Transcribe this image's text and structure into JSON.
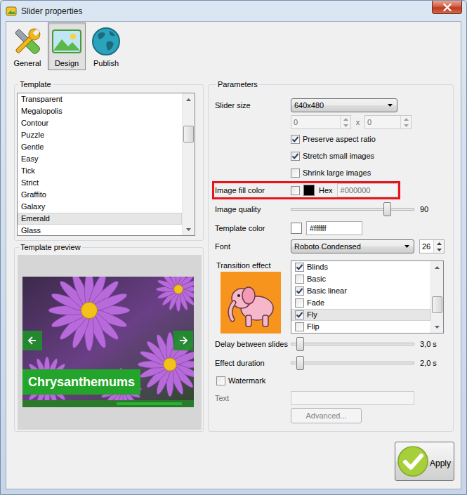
{
  "window": {
    "title": "Slider properties"
  },
  "toolbar": [
    {
      "label": "General",
      "selected": false
    },
    {
      "label": "Design",
      "selected": true
    },
    {
      "label": "Publish",
      "selected": false
    }
  ],
  "template": {
    "title": "Template",
    "scroll_level": 0.2,
    "items": [
      {
        "label": "Transparent",
        "selected": false
      },
      {
        "label": "Megalopolis",
        "selected": false
      },
      {
        "label": "Contour",
        "selected": false
      },
      {
        "label": "Puzzle",
        "selected": false
      },
      {
        "label": "Gentle",
        "selected": false
      },
      {
        "label": "Easy",
        "selected": false
      },
      {
        "label": "Tick",
        "selected": false
      },
      {
        "label": "Strict",
        "selected": false
      },
      {
        "label": "Graffito",
        "selected": false
      },
      {
        "label": "Galaxy",
        "selected": false
      },
      {
        "label": "Emerald",
        "selected": true
      },
      {
        "label": "Glass",
        "selected": false
      }
    ]
  },
  "preview": {
    "title": "Template preview",
    "caption": "Chrysanthemums"
  },
  "parameters": {
    "title": "Parameters",
    "slider_size": {
      "label": "Slider size",
      "value": "640x480"
    },
    "custom_size": {
      "width": "0",
      "separator": "x",
      "height": "0",
      "disabled": true
    },
    "options": [
      {
        "label": "Preserve aspect ratio",
        "checked": true
      },
      {
        "label": "Stretch small images",
        "checked": true
      },
      {
        "label": "Shrink large images",
        "checked": false
      }
    ],
    "fill": {
      "label": "Image fill color",
      "checked": false,
      "hex_label": "Hex",
      "value": "#000000",
      "disabled": true,
      "highlighted": true
    },
    "quality": {
      "label": "Image quality",
      "level": 0.8,
      "reading": "90"
    },
    "template_color": {
      "label": "Template color",
      "value": "#ffffff"
    },
    "font": {
      "label": "Font",
      "value": "Roboto Condensed",
      "size": "26"
    },
    "transition": {
      "label": "Transition effect",
      "scroll_level": 0.75,
      "items": [
        {
          "label": "Blinds",
          "checked": true,
          "selected": false
        },
        {
          "label": "Basic",
          "checked": false,
          "selected": false
        },
        {
          "label": "Basic linear",
          "checked": true,
          "selected": false
        },
        {
          "label": "Fade",
          "checked": false,
          "selected": false
        },
        {
          "label": "Fly",
          "checked": true,
          "selected": true
        },
        {
          "label": "Flip",
          "checked": false,
          "selected": false
        }
      ]
    },
    "delay": {
      "label": "Delay between slides",
      "level": 0.05,
      "reading": "3,0 s"
    },
    "duration": {
      "label": "Effect duration",
      "level": 0.05,
      "reading": "2,0 s"
    },
    "watermark": {
      "label": "Watermark",
      "checked": false
    },
    "text": {
      "label": "Text",
      "value": "",
      "disabled": true
    },
    "advanced": {
      "label": "Advanced...",
      "disabled": true
    }
  },
  "apply": {
    "label": "Apply"
  }
}
